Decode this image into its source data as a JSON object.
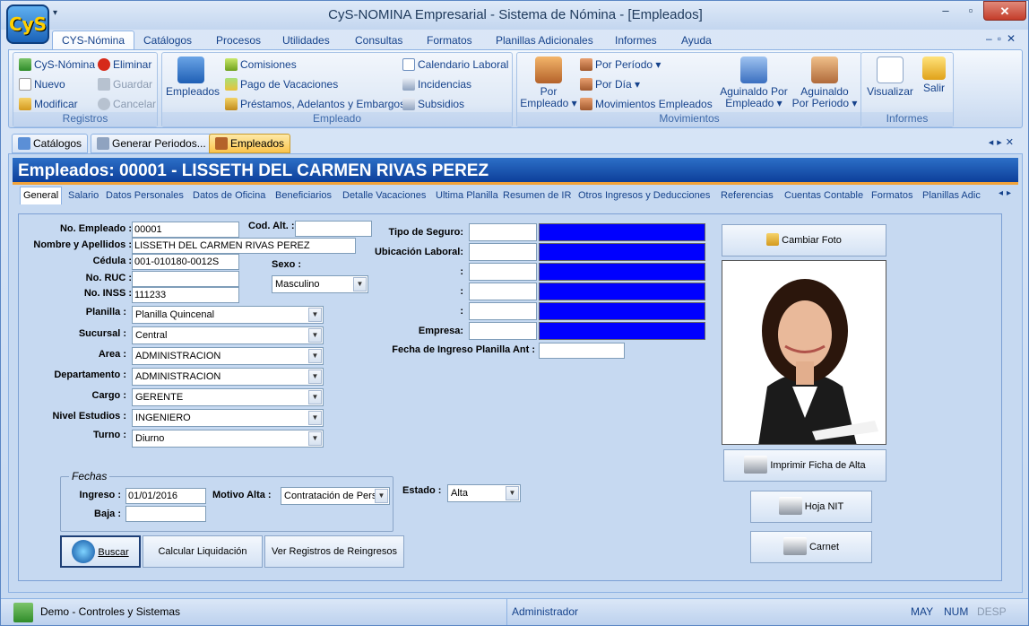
{
  "window": {
    "title": "CyS-NOMINA Empresarial - Sistema de Nómina - [Empleados]",
    "logo": "CyS",
    "min": "–",
    "max": "▫",
    "close": "✕",
    "qa": "▾"
  },
  "menu": {
    "items": [
      "CYS-Nómina",
      "Catálogos",
      "Procesos",
      "Utilidades",
      "Consultas",
      "Formatos",
      "Planillas Adicionales",
      "Informes",
      "Ayuda"
    ],
    "mdi": "–▫✕"
  },
  "ribbon": {
    "registros": {
      "label": "Registros",
      "cys": "CyS-Nómina",
      "eliminar": "Eliminar",
      "nuevo": "Nuevo",
      "guardar": "Guardar",
      "modificar": "Modificar",
      "cancelar": "Cancelar"
    },
    "empleado": {
      "label": "Empleado",
      "empleados": "Empleados",
      "comisiones": "Comisiones",
      "vacaciones": "Pago de Vacaciones",
      "prestamos": "Préstamos, Adelantos y Embargos",
      "calendario": "Calendario Laboral",
      "incidencias": "Incidencias",
      "subsidios": "Subsidios"
    },
    "movimientos": {
      "label": "Movimientos",
      "por_empleado_1": "Por",
      "por_empleado_2": "Empleado ▾",
      "por_periodo": "Por Período ▾",
      "por_dia": "Por Día ▾",
      "mov_empleados": "Movimientos Empleados",
      "agui_emp_1": "Aguinaldo Por",
      "agui_emp_2": "Empleado ▾",
      "agui_per_1": "Aguinaldo",
      "agui_per_2": "Por Periodo ▾"
    },
    "informes": {
      "label": "Informes",
      "visualizar": "Visualizar",
      "salir": "Salir"
    }
  },
  "doctabs": [
    "Catálogos",
    "Generar Periodos...",
    "Empleados"
  ],
  "header": "Empleados: 00001 - LISSETH DEL CARMEN RIVAS PEREZ",
  "subtabs": [
    "General",
    "Salario",
    "Datos Personales",
    "Datos de Oficina",
    "Beneficiarios",
    "Detalle Vacaciones",
    "Ultima Planilla",
    "Resumen de IR",
    "Otros Ingresos y Deducciones",
    "Referencias",
    "Cuentas Contable",
    "Formatos",
    "Planillas Adic"
  ],
  "form": {
    "no_empleado_l": "No. Empleado :",
    "no_empleado": "00001",
    "cod_alt_l": "Cod. Alt. :",
    "cod_alt": "",
    "nombre_l": "Nombre y Apellidos :",
    "nombre": "LISSETH DEL CARMEN RIVAS PEREZ",
    "cedula_l": "Cédula :",
    "cedula": "001-010180-0012S",
    "ruc_l": "No. RUC :",
    "ruc": "",
    "inss_l": "No. INSS :",
    "inss": "111233",
    "sexo_l": "Sexo :",
    "sexo": "Masculino",
    "planilla_l": "Planilla :",
    "planilla": "Planilla Quincenal",
    "sucursal_l": "Sucursal :",
    "sucursal": "Central",
    "area_l": "Area :",
    "area": "ADMINISTRACION",
    "depto_l": "Departamento :",
    "depto": "ADMINISTRACION",
    "cargo_l": "Cargo :",
    "cargo": "GERENTE",
    "nivel_l": "Nivel Estudios :",
    "nivel": "INGENIERO",
    "turno_l": "Turno :",
    "turno": "Diurno",
    "seguro_l": "Tipo de Seguro:",
    "ubicacion_l": "Ubicación Laboral:",
    "colon": ":",
    "empresa_l": "Empresa:",
    "fecha_ant_l": "Fecha de Ingreso Planilla Ant :",
    "fechas_l": "Fechas",
    "ingreso_l": "Ingreso :",
    "ingreso": "01/01/2016",
    "baja_l": "Baja :",
    "baja": "",
    "motivo_l": "Motivo Alta :",
    "motivo": "Contratación de Pers",
    "estado_l": "Estado :",
    "estado": "Alta",
    "buscar": "Buscar",
    "calcular": "Calcular Liquidación",
    "reingresos": "Ver Registros de Reingresos",
    "cambiar_foto": "Cambiar Foto",
    "imprimir": "Imprimir Ficha de Alta",
    "nit": "Hoja NIT",
    "carnet": "Carnet"
  },
  "status": {
    "empresa": "Demo - Controles y Sistemas",
    "usuario": "Administrador",
    "may": "MAY",
    "num": "NUM",
    "desp": "DESP"
  }
}
